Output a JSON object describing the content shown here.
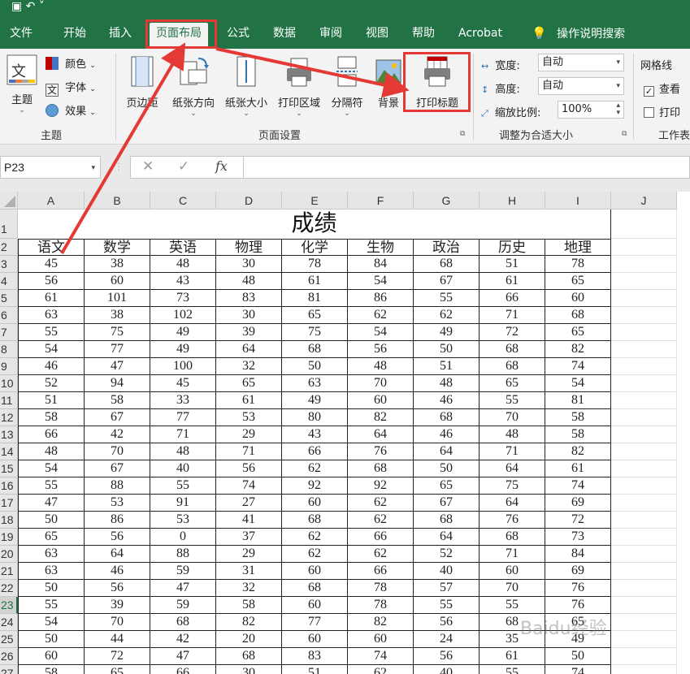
{
  "ribbon_tabs": [
    "文件",
    "开始",
    "插入",
    "页面布局",
    "公式",
    "数据",
    "审阅",
    "视图",
    "帮助",
    "Acrobat",
    "操作说明搜索"
  ],
  "active_tab": "页面布局",
  "ribbon": {
    "themes": {
      "group_label": "主题",
      "theme_button": "主题",
      "colors": "颜色",
      "fonts": "字体",
      "effects": "效果"
    },
    "page_setup": {
      "group_label": "页面设置",
      "margins": "页边距",
      "orientation": "纸张方向",
      "size": "纸张大小",
      "print_area": "打印区域",
      "breaks": "分隔符",
      "background": "背景",
      "print_titles": "打印标题"
    },
    "scale_to_fit": {
      "group_label": "调整为合适大小",
      "width_label": "宽度:",
      "width_value": "自动",
      "height_label": "高度:",
      "height_value": "自动",
      "scale_label": "缩放比例:",
      "scale_value": "100%"
    },
    "sheet_options": {
      "group_label": "工作表",
      "gridlines_label": "网格线",
      "view_label": "查看",
      "view_checked": true,
      "print_label": "打印",
      "print_checked": false
    }
  },
  "formula_bar": {
    "name_box": "P23",
    "fx_label": "fx",
    "content": ""
  },
  "sheet": {
    "columns": [
      "A",
      "B",
      "C",
      "D",
      "E",
      "F",
      "G",
      "H",
      "I",
      "J"
    ],
    "row_numbers": [
      "1",
      "2",
      "3",
      "4",
      "5",
      "6",
      "7",
      "8",
      "9",
      "10",
      "11",
      "12",
      "13",
      "14",
      "15",
      "16",
      "17",
      "18",
      "19",
      "20",
      "21",
      "22",
      "23",
      "24",
      "25",
      "26",
      "27"
    ],
    "selected_row": "23",
    "title": "成绩",
    "headers": [
      "语文",
      "数学",
      "英语",
      "物理",
      "化学",
      "生物",
      "政治",
      "历史",
      "地理"
    ],
    "rows": [
      [
        "45",
        "38",
        "48",
        "30",
        "78",
        "84",
        "68",
        "51",
        "78"
      ],
      [
        "56",
        "60",
        "43",
        "48",
        "61",
        "54",
        "67",
        "61",
        "65"
      ],
      [
        "61",
        "101",
        "73",
        "83",
        "81",
        "86",
        "55",
        "66",
        "60"
      ],
      [
        "63",
        "38",
        "102",
        "30",
        "65",
        "62",
        "62",
        "71",
        "68"
      ],
      [
        "55",
        "75",
        "49",
        "39",
        "75",
        "54",
        "49",
        "72",
        "65"
      ],
      [
        "54",
        "77",
        "49",
        "64",
        "68",
        "56",
        "50",
        "68",
        "82"
      ],
      [
        "46",
        "47",
        "100",
        "32",
        "50",
        "48",
        "51",
        "68",
        "74"
      ],
      [
        "52",
        "94",
        "45",
        "65",
        "63",
        "70",
        "48",
        "65",
        "54"
      ],
      [
        "51",
        "58",
        "33",
        "61",
        "49",
        "60",
        "46",
        "55",
        "81"
      ],
      [
        "58",
        "67",
        "77",
        "53",
        "80",
        "82",
        "68",
        "70",
        "58"
      ],
      [
        "66",
        "42",
        "71",
        "29",
        "43",
        "64",
        "46",
        "48",
        "58"
      ],
      [
        "48",
        "70",
        "48",
        "71",
        "66",
        "76",
        "64",
        "71",
        "82"
      ],
      [
        "54",
        "67",
        "40",
        "56",
        "62",
        "68",
        "50",
        "64",
        "61"
      ],
      [
        "55",
        "88",
        "55",
        "74",
        "92",
        "92",
        "65",
        "75",
        "74"
      ],
      [
        "47",
        "53",
        "91",
        "27",
        "60",
        "62",
        "67",
        "64",
        "69"
      ],
      [
        "50",
        "86",
        "53",
        "41",
        "68",
        "62",
        "68",
        "76",
        "72"
      ],
      [
        "65",
        "56",
        "0",
        "37",
        "62",
        "66",
        "64",
        "68",
        "73"
      ],
      [
        "63",
        "64",
        "88",
        "29",
        "62",
        "62",
        "52",
        "71",
        "84"
      ],
      [
        "63",
        "46",
        "59",
        "31",
        "60",
        "66",
        "40",
        "60",
        "69"
      ],
      [
        "50",
        "56",
        "47",
        "32",
        "68",
        "78",
        "57",
        "70",
        "76"
      ],
      [
        "55",
        "39",
        "59",
        "58",
        "60",
        "78",
        "55",
        "55",
        "76"
      ],
      [
        "54",
        "70",
        "68",
        "82",
        "77",
        "82",
        "56",
        "68",
        "65"
      ],
      [
        "50",
        "44",
        "42",
        "20",
        "60",
        "60",
        "24",
        "35",
        "49"
      ],
      [
        "60",
        "72",
        "47",
        "68",
        "83",
        "74",
        "56",
        "61",
        "50"
      ],
      [
        "58",
        "65",
        "66",
        "30",
        "51",
        "62",
        "40",
        "55",
        "74"
      ]
    ]
  },
  "watermark": "Baidu经验",
  "colors": {
    "excel_green": "#217346",
    "annotation_red": "#e53935"
  }
}
